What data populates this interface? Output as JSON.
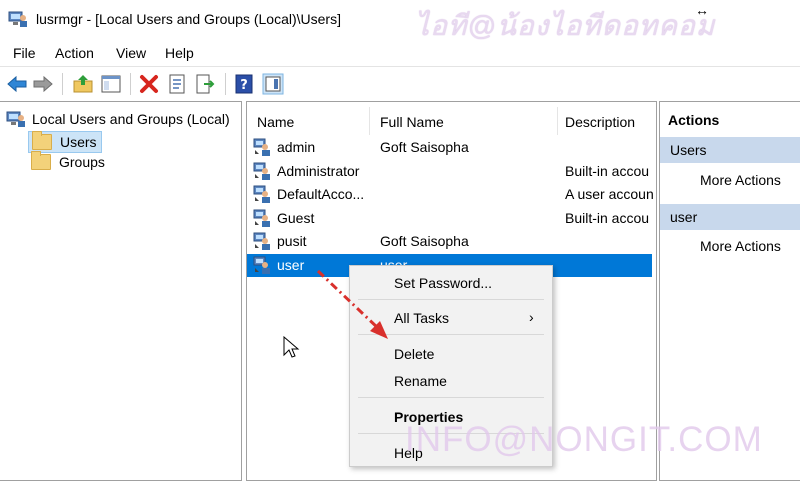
{
  "window": {
    "title": "lusrmgr - [Local Users and Groups (Local)\\Users]",
    "watermark_top": "ไอที@น้องไอทีดอทคอม",
    "watermark_bottom": "INFO@NONGIT.COM"
  },
  "menu": [
    "File",
    "Action",
    "View",
    "Help"
  ],
  "tree": {
    "root": "Local Users and Groups (Local)",
    "children": [
      "Users",
      "Groups"
    ],
    "selected": "Users"
  },
  "list": {
    "columns": [
      "Name",
      "Full Name",
      "Description"
    ],
    "rows": [
      {
        "name": "admin",
        "full_name": "Goft Saisopha",
        "description": ""
      },
      {
        "name": "Administrator",
        "full_name": "",
        "description": "Built-in accou"
      },
      {
        "name": "DefaultAcco...",
        "full_name": "",
        "description": "A user accoun"
      },
      {
        "name": "Guest",
        "full_name": "",
        "description": "Built-in accou"
      },
      {
        "name": "pusit",
        "full_name": "Goft Saisopha",
        "description": ""
      },
      {
        "name": "user",
        "full_name": "user",
        "description": ""
      }
    ],
    "selected_row": "user"
  },
  "actions": {
    "title": "Actions",
    "groups": [
      {
        "label": "Users",
        "link": "More Actions"
      },
      {
        "label": "user",
        "link": "More Actions"
      }
    ]
  },
  "context_menu": {
    "items": [
      "Set Password...",
      "All Tasks",
      "Delete",
      "Rename",
      "Properties",
      "Help"
    ],
    "submenu_arrow": "›"
  },
  "colors": {
    "selection": "#0078d7",
    "actions_group_bg": "#c8d8ec",
    "arrow_red": "#d9302c"
  }
}
